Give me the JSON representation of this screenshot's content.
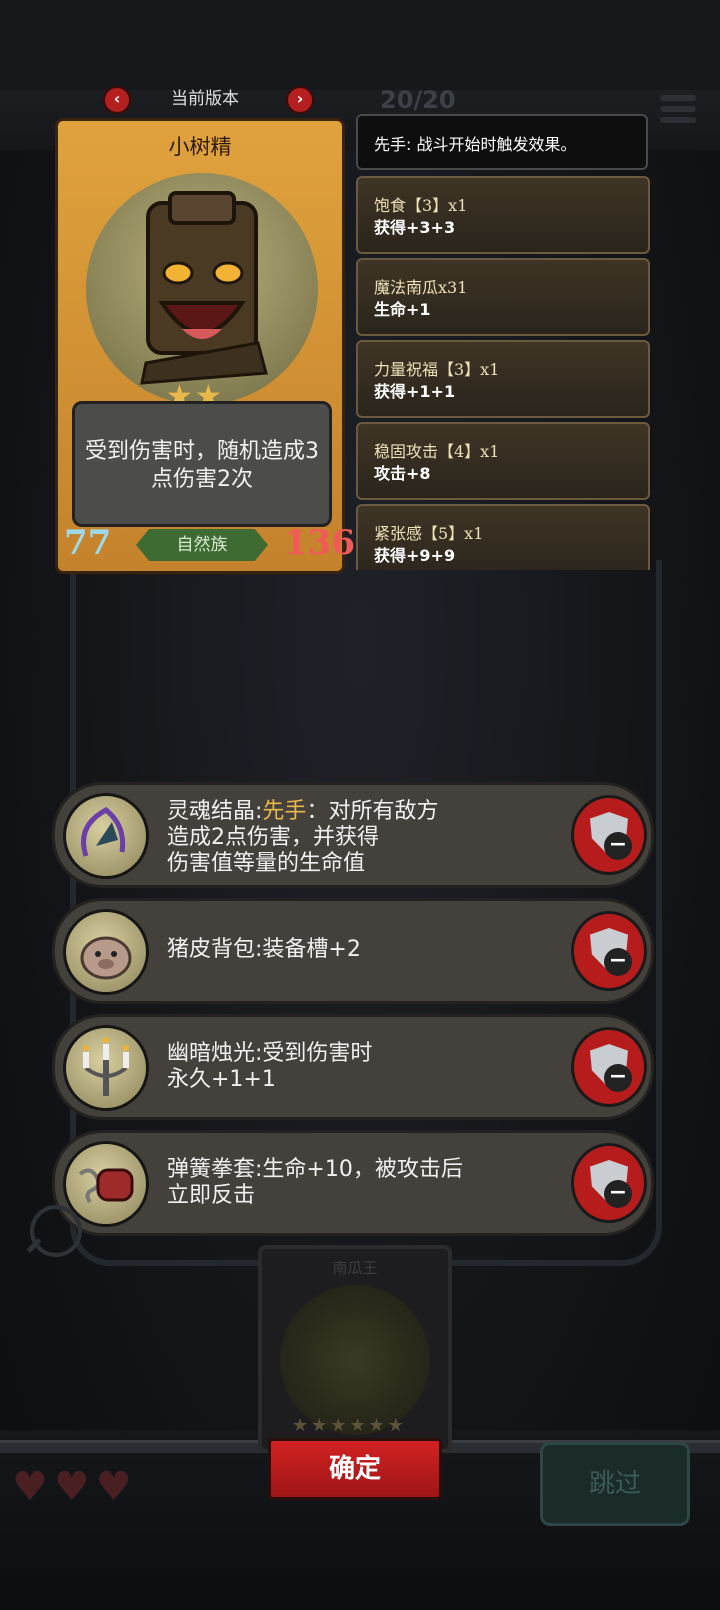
{
  "header": {
    "version_label": "当前版本",
    "prev_icon": "chevron-left-icon",
    "next_icon": "chevron-right-icon",
    "count_text": "20/20"
  },
  "card": {
    "name": "小树精",
    "description": "受到伤害时，随机造成3点伤害2次",
    "attack": "77",
    "health": "136",
    "race": "自然族",
    "stars": "★★"
  },
  "effects": {
    "header": "先手: 战斗开始时触发效果。",
    "items": [
      {
        "title": "饱食【3】x1",
        "value": "获得+3+3"
      },
      {
        "title": "魔法南瓜x31",
        "value": "生命+1"
      },
      {
        "title": "力量祝福【3】x1",
        "value": "获得+1+1"
      },
      {
        "title": "稳固攻击【4】x1",
        "value": "攻击+8"
      },
      {
        "title": "紧张感【5】x1",
        "value": "获得+9+9"
      }
    ]
  },
  "equipment": [
    {
      "name": "灵魂结晶:",
      "keyword": "先手",
      "rest": "：对所有敌方",
      "line2": "造成2点伤害，并获得",
      "line3": "伤害值等量的生命值",
      "icon": "soul-crystal-icon"
    },
    {
      "name": "猪皮背包:装备槽+2",
      "icon": "pig-backpack-icon"
    },
    {
      "name": "幽暗烛光:受到伤害时",
      "line2": "永久+1+1",
      "icon": "candelabra-icon"
    },
    {
      "name": "弹簧拳套:生命+10，被攻击后",
      "line2": "立即反击",
      "icon": "spring-glove-icon"
    }
  ],
  "bottom": {
    "mini_card_name": "南瓜王",
    "mini_stars": "★★★★★★",
    "confirm_label": "确定",
    "skip_label": "跳过",
    "hearts": "♥♥♥"
  },
  "colors": {
    "accent_gold": "#e8b94a",
    "confirm_red": "#d32222",
    "remove_red": "#b71c1c"
  }
}
